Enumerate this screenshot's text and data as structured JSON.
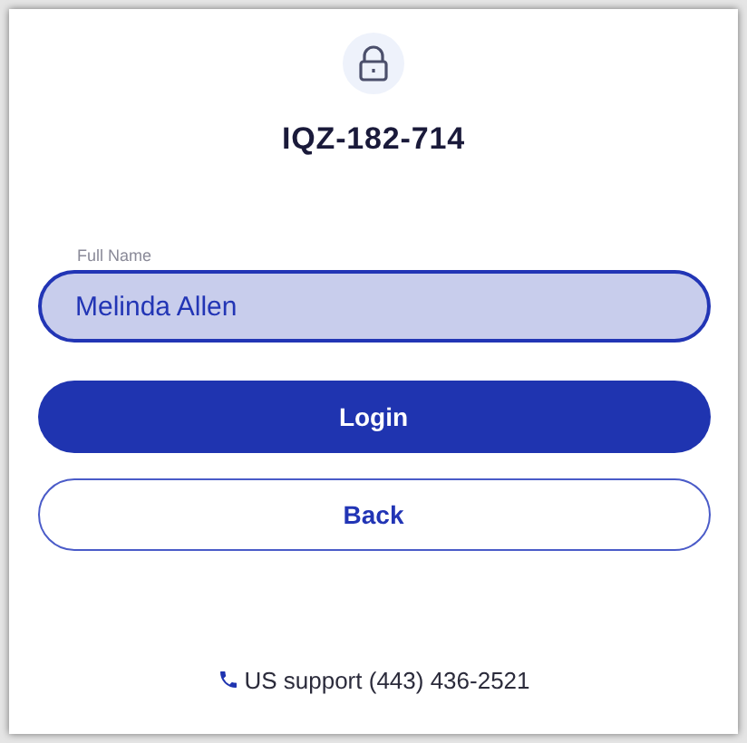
{
  "title": "IQZ-182-714",
  "field": {
    "label": "Full Name",
    "value": "Melinda Allen"
  },
  "buttons": [
    {
      "label": "Login",
      "kind": "primary"
    },
    {
      "label": "Back",
      "kind": "secondary"
    }
  ],
  "support": "US support (443) 436-2521"
}
